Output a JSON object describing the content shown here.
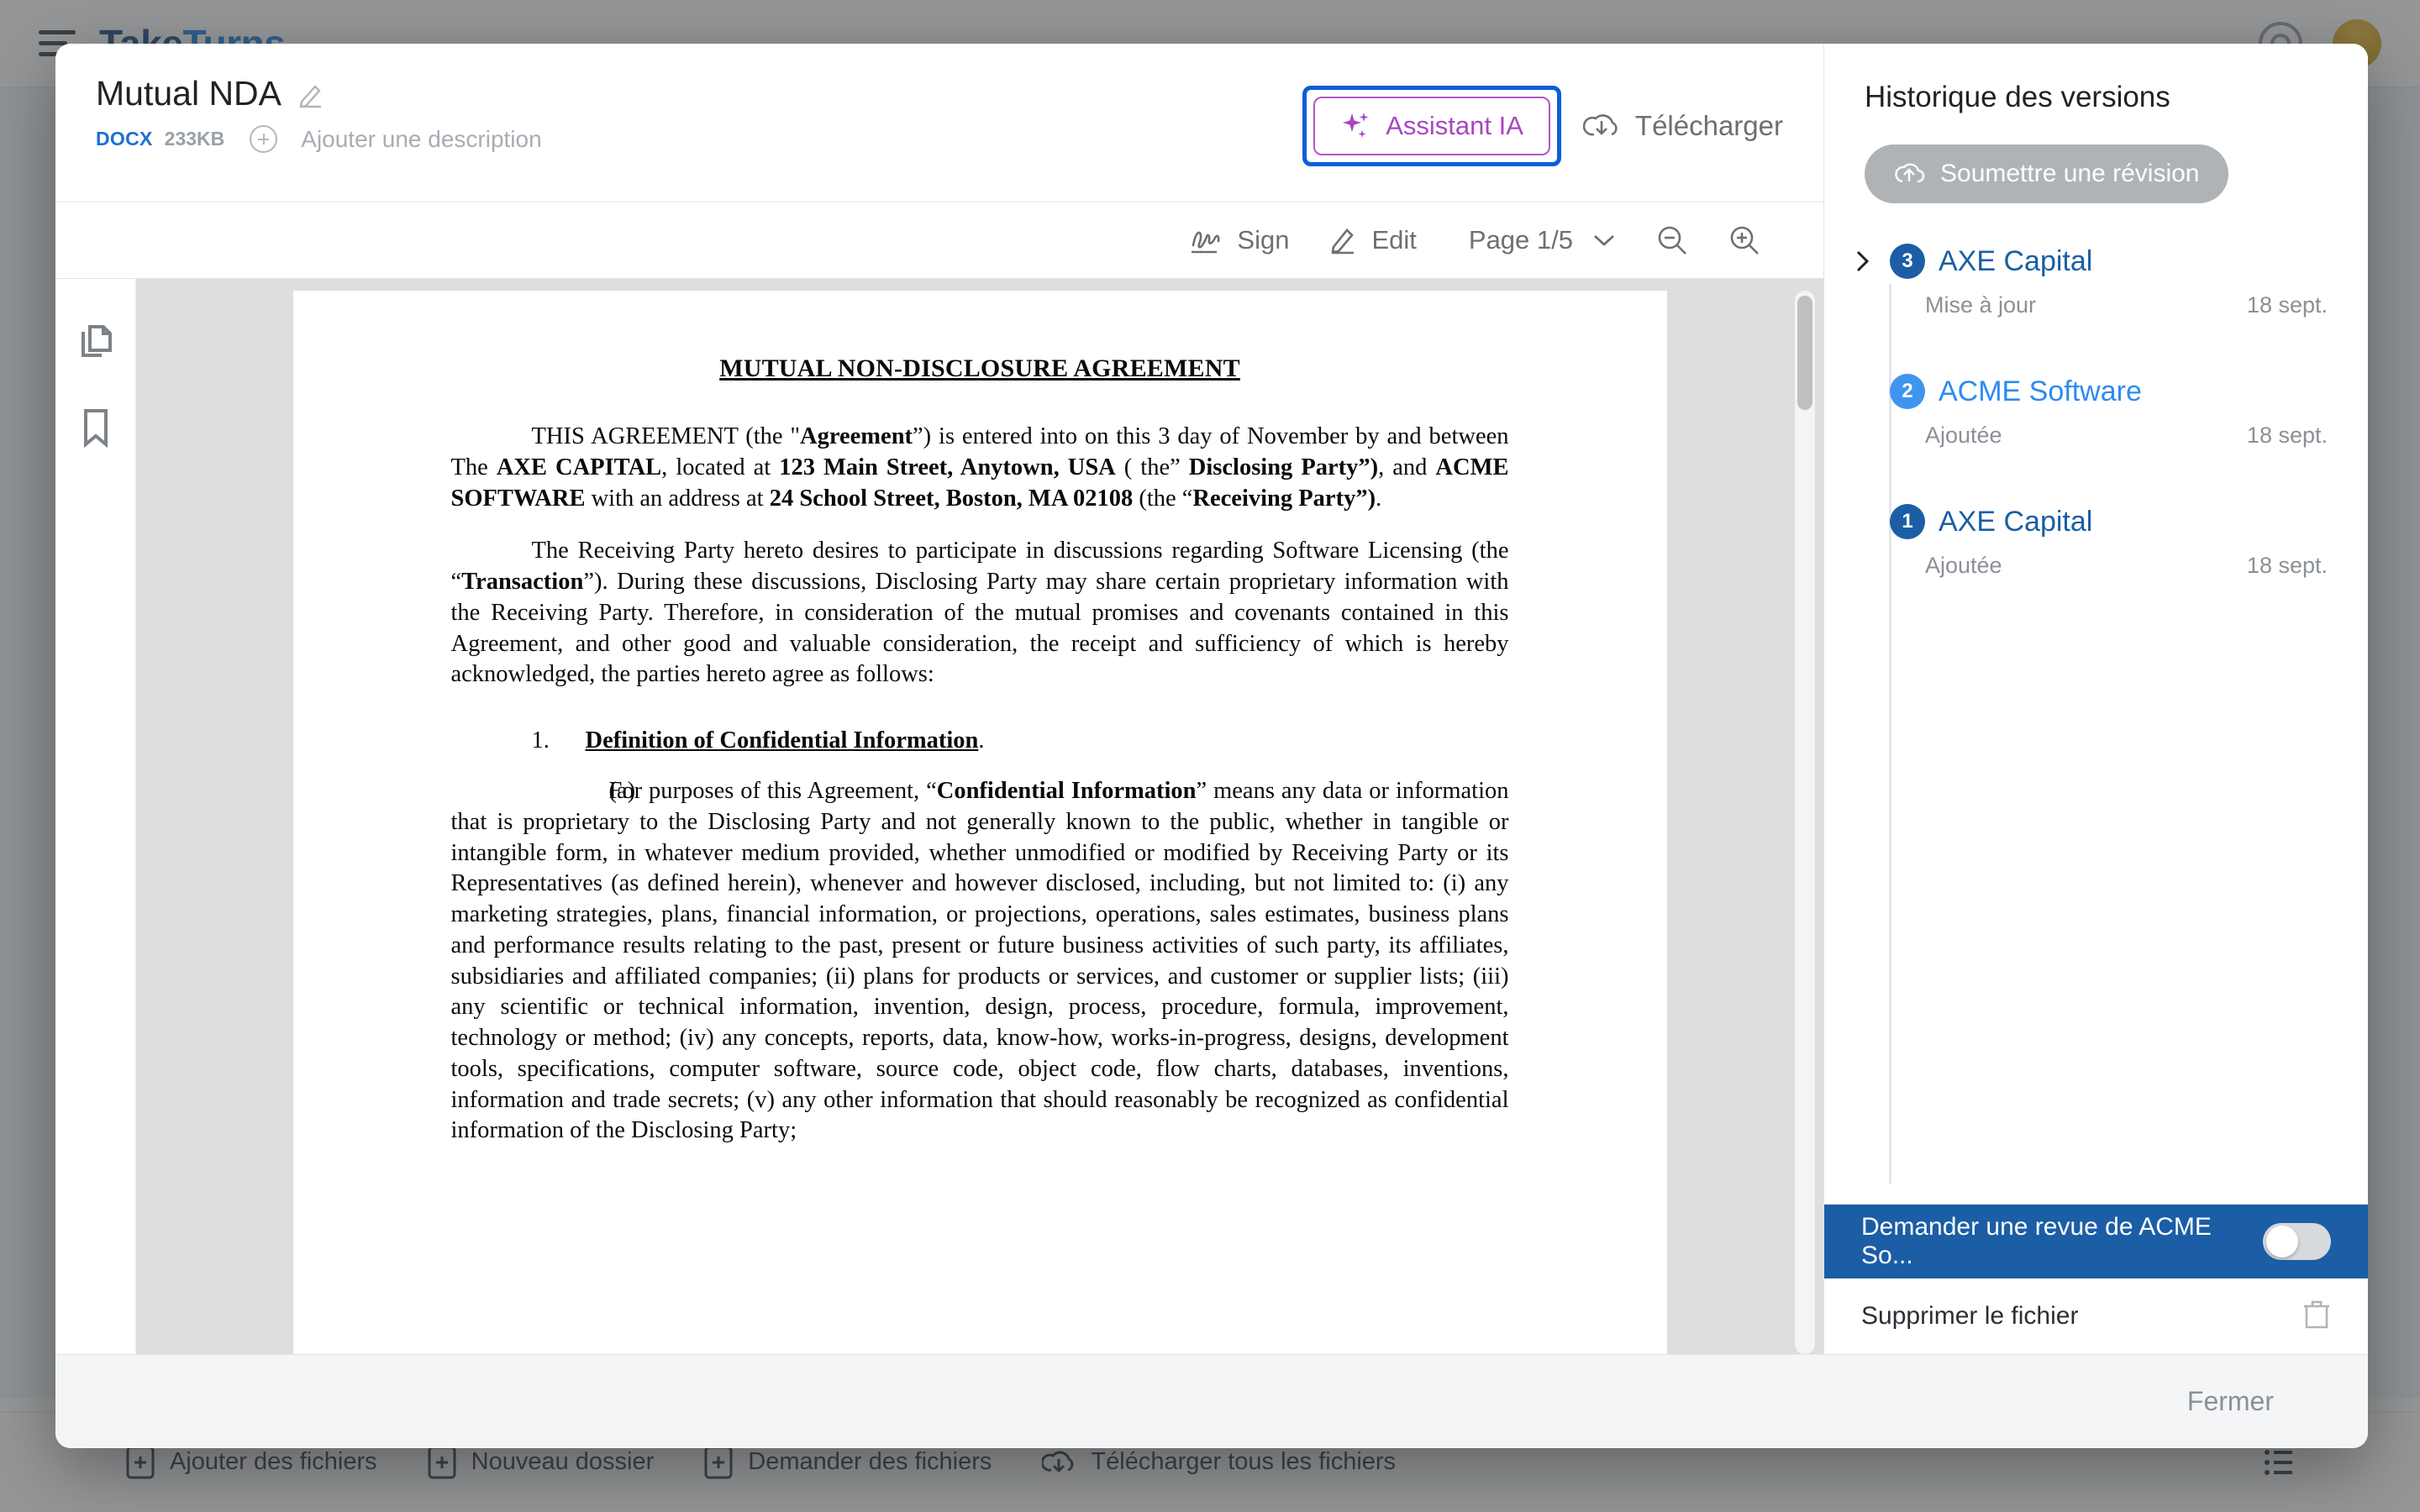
{
  "background": {
    "brand_part1": "Take",
    "brand_part2": "Turns",
    "actions": [
      {
        "label": "Ajouter des fichiers",
        "icon": "file-plus-icon"
      },
      {
        "label": "Nouveau dossier",
        "icon": "folder-plus-icon"
      },
      {
        "label": "Demander des fichiers",
        "icon": "file-request-icon"
      },
      {
        "label": "Télécharger tous les fichiers",
        "icon": "download-cloud-icon"
      }
    ],
    "list_view_icon": "list-view-icon",
    "help_icon": "help-circle-icon",
    "avatar": "user-avatar"
  },
  "document_header": {
    "title": "Mutual NDA",
    "edit_icon": "pencil-icon",
    "file_type": "DOCX",
    "file_size": "233KB",
    "add_description_placeholder": "Ajouter une description",
    "ai_assistant_label": "Assistant IA",
    "ai_assistant_icon": "sparkles-icon",
    "ai_accent_color": "#a946c2",
    "focus_ring_color": "#0a5fd6",
    "download_label": "Télécharger",
    "download_icon": "download-cloud-icon"
  },
  "toolbar": {
    "sign_label": "Sign",
    "sign_icon": "signature-icon",
    "edit_label": "Edit",
    "edit_icon": "pencil-icon",
    "page_label": "Page 1/5",
    "page_chevron_icon": "chevron-down-icon",
    "zoom_out_icon": "zoom-out-icon",
    "zoom_in_icon": "zoom-in-icon"
  },
  "rail": {
    "pages_icon": "pages-icon",
    "bookmark_icon": "bookmark-icon"
  },
  "document": {
    "heading": "MUTUAL NON-DISCLOSURE AGREEMENT",
    "p1_a": "THIS AGREEMENT (the \"",
    "p1_b": "Agreement",
    "p1_c": "”) is entered into on this 3 day of  November by and between  The ",
    "p1_d": "AXE CAPITAL",
    "p1_e": ", located at  ",
    "p1_f": "123 Main Street, Anytown, USA",
    "p1_g": "  ( the” ",
    "p1_h": "Disclosing Party”)",
    "p1_i": ", and ",
    "p1_j": "ACME SOFTWARE",
    "p1_k": " with an address at  ",
    "p1_l": "24 School Street, Boston, MA 02108",
    "p1_m": " (the “",
    "p1_n": "Receiving Party”)",
    "p1_o": ".",
    "p2_a": "The Receiving Party hereto desires to participate in discussions regarding Software Licensing (the  “",
    "p2_b": "Transaction",
    "p2_c": "”).   During these discussions, Disclosing Party may share certain proprietary information with the Receiving Party.  Therefore, in consideration of the mutual promises and covenants contained in this Agreement, and other good and valuable consideration, the receipt and sufficiency of which is hereby acknowledged, the parties hereto agree as follows:",
    "sec1_num": "1.",
    "sec1_title": "Definition of Confidential Information",
    "sec1_dot": ".",
    "sub_a_label": "(a)",
    "sub_a_1": "For purposes of this Agreement, “",
    "sub_a_bold1": "Confidential Information",
    "sub_a_2": "” means any data or information that is proprietary to the Disclosing Party and not generally known to the public, whether in tangible or intangible form, in whatever medium provided, whether unmodified or modified by Receiving Party or its Representatives (as defined herein), whenever and however disclosed, including, but not limited to: (i) any marketing strategies, plans, financial information, or projections, operations, sales estimates, business plans and performance results relating to the past, present or future business activities of such party, its affiliates, subsidiaries and affiliated companies; (ii) plans for products or services, and customer or supplier lists; (iii) any scientific or technical information, invention, design, process, procedure, formula, improvement, technology or method; (iv) any concepts, reports, data, know-how, works-in-progress, designs, development tools, specifications, computer software, source code, object code, flow charts, databases, inventions, information and trade secrets; (v) any other information that should reasonably be recognized as confidential information of the Disclosing Party;"
  },
  "versions_panel": {
    "title": "Historique des versions",
    "submit_label": "Soumettre une révision",
    "submit_icon": "upload-cloud-icon",
    "items": [
      {
        "number": "3",
        "name": "AXE Capital",
        "status": "Mise à jour",
        "date": "18 sept.",
        "color": "#1b5ea5",
        "expandable": true,
        "chevron_icon": "chevron-right-icon"
      },
      {
        "number": "2",
        "name": "ACME Software",
        "status": "Ajoutée",
        "date": "18 sept.",
        "color": "#3f95ed",
        "expandable": false,
        "chevron_icon": ""
      },
      {
        "number": "1",
        "name": "AXE Capital",
        "status": "Ajoutée",
        "date": "18 sept.",
        "color": "#1b5ea5",
        "expandable": false,
        "chevron_icon": ""
      }
    ],
    "review_row_label": "Demander une revue de ACME So...",
    "review_row_bg": "#1b5ea5",
    "review_toggle_state": "off",
    "delete_label": "Supprimer le fichier",
    "delete_icon": "trash-icon"
  },
  "footer": {
    "close_label": "Fermer"
  }
}
